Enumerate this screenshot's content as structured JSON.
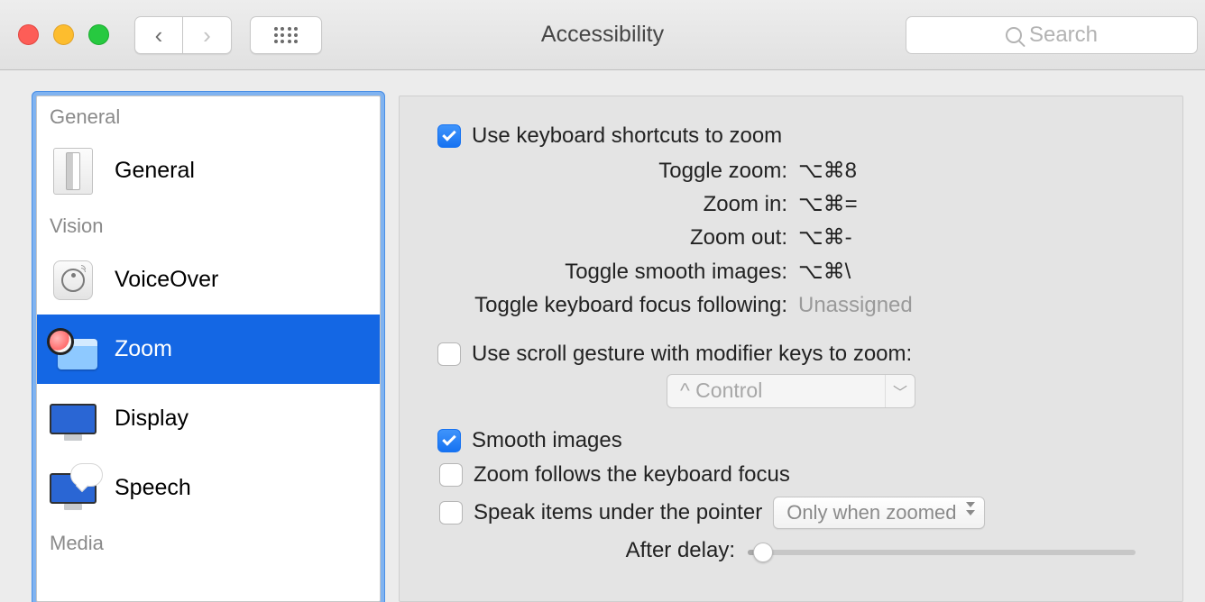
{
  "window_title": "Accessibility",
  "search_placeholder": "Search",
  "sidebar": {
    "sections": {
      "general": "General",
      "vision": "Vision",
      "media": "Media"
    },
    "items": {
      "general": {
        "label": "General"
      },
      "voiceover": {
        "label": "VoiceOver"
      },
      "zoom": {
        "label": "Zoom"
      },
      "display": {
        "label": "Display"
      },
      "speech": {
        "label": "Speech"
      }
    }
  },
  "main": {
    "use_keyboard_shortcuts": "Use keyboard shortcuts to zoom",
    "shortcuts": {
      "toggle_zoom": {
        "label": "Toggle zoom:",
        "keys": "⌥⌘8"
      },
      "zoom_in": {
        "label": "Zoom in:",
        "keys": "⌥⌘="
      },
      "zoom_out": {
        "label": "Zoom out:",
        "keys": "⌥⌘-"
      },
      "toggle_smooth": {
        "label": "Toggle smooth images:",
        "keys": "⌥⌘\\"
      },
      "toggle_focus": {
        "label": "Toggle keyboard focus following:",
        "keys": "Unassigned"
      }
    },
    "use_scroll_gesture": "Use scroll gesture with modifier keys to zoom:",
    "modifier_select": "^ Control",
    "smooth_images": "Smooth images",
    "follows_focus": "Zoom follows the keyboard focus",
    "speak_items": "Speak items under the pointer",
    "speak_mode": "Only when zoomed",
    "after_delay": "After delay:"
  }
}
